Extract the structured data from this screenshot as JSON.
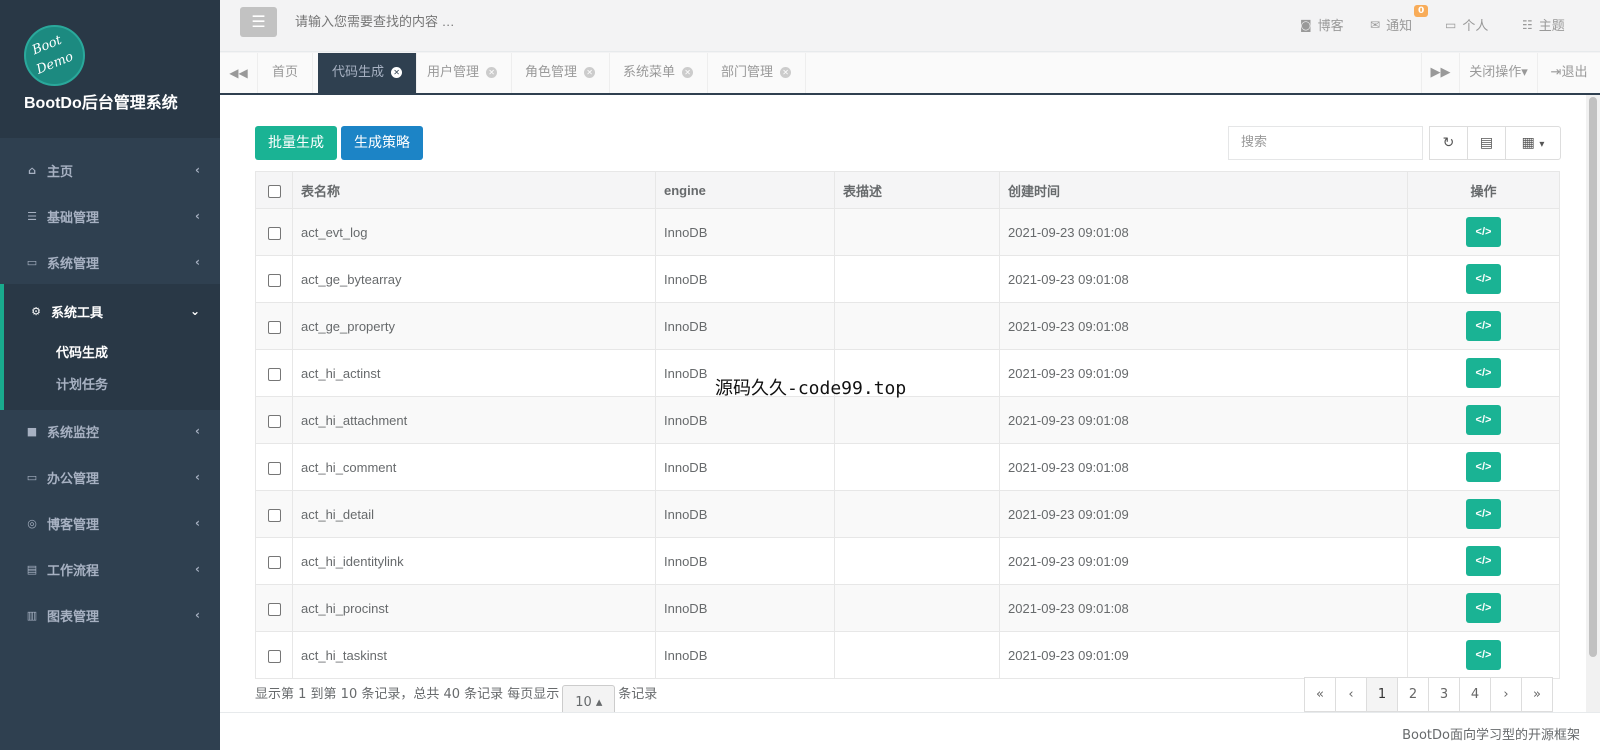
{
  "app": {
    "logo_line1": "Boot",
    "logo_line2": "Demo",
    "title": "BootDo后台管理系统"
  },
  "sidebar": {
    "items": [
      {
        "icon": "home-icon",
        "glyph": "⌂",
        "label": "主页"
      },
      {
        "icon": "bars-icon",
        "glyph": "☰",
        "label": "基础管理"
      },
      {
        "icon": "desktop-icon",
        "glyph": "▭",
        "label": "系统管理"
      },
      {
        "icon": "gear-icon",
        "glyph": "⚙",
        "label": "系统工具"
      },
      {
        "icon": "video-icon",
        "glyph": "■",
        "label": "系统监控"
      },
      {
        "icon": "laptop-icon",
        "glyph": "▭",
        "label": "办公管理"
      },
      {
        "icon": "rss-icon",
        "glyph": "◎",
        "label": "博客管理"
      },
      {
        "icon": "print-icon",
        "glyph": "▤",
        "label": "工作流程"
      },
      {
        "icon": "bar-chart-icon",
        "glyph": "▥",
        "label": "图表管理"
      }
    ],
    "subitems": [
      {
        "label": "代码生成"
      },
      {
        "label": "计划任务"
      }
    ]
  },
  "topbar": {
    "search_placeholder": "请输入您需要查找的内容 …",
    "blog_label": "博客",
    "notify_label": "通知",
    "notify_count": "0",
    "personal_label": "个人",
    "theme_label": "主题"
  },
  "tabs": {
    "items": [
      {
        "label": "首页"
      },
      {
        "label": "代码生成"
      },
      {
        "label": "用户管理"
      },
      {
        "label": "角色管理"
      },
      {
        "label": "系统菜单"
      },
      {
        "label": "部门管理"
      }
    ],
    "close_ops_label": "关闭操作",
    "logout_label": "退出"
  },
  "toolbar": {
    "batch_label": "批量生成",
    "strategy_label": "生成策略",
    "search_placeholder": "搜索"
  },
  "table": {
    "headers": [
      "表名称",
      "engine",
      "表描述",
      "创建时间",
      "操作"
    ],
    "rows": [
      {
        "name": "act_evt_log",
        "engine": "InnoDB",
        "desc": "",
        "created": "2021-09-23 09:01:08"
      },
      {
        "name": "act_ge_bytearray",
        "engine": "InnoDB",
        "desc": "",
        "created": "2021-09-23 09:01:08"
      },
      {
        "name": "act_ge_property",
        "engine": "InnoDB",
        "desc": "",
        "created": "2021-09-23 09:01:08"
      },
      {
        "name": "act_hi_actinst",
        "engine": "InnoDB",
        "desc": "",
        "created": "2021-09-23 09:01:09"
      },
      {
        "name": "act_hi_attachment",
        "engine": "InnoDB",
        "desc": "",
        "created": "2021-09-23 09:01:08"
      },
      {
        "name": "act_hi_comment",
        "engine": "InnoDB",
        "desc": "",
        "created": "2021-09-23 09:01:08"
      },
      {
        "name": "act_hi_detail",
        "engine": "InnoDB",
        "desc": "",
        "created": "2021-09-23 09:01:09"
      },
      {
        "name": "act_hi_identitylink",
        "engine": "InnoDB",
        "desc": "",
        "created": "2021-09-23 09:01:09"
      },
      {
        "name": "act_hi_procinst",
        "engine": "InnoDB",
        "desc": "",
        "created": "2021-09-23 09:01:08"
      },
      {
        "name": "act_hi_taskinst",
        "engine": "InnoDB",
        "desc": "",
        "created": "2021-09-23 09:01:09"
      }
    ],
    "action_glyph": "</>"
  },
  "pagination": {
    "info_prefix": "显示第 1 到第 10 条记录，总共 40 条记录 每页显示",
    "page_size": "10 ▴",
    "info_suffix": "条记录",
    "pages": [
      "«",
      "‹",
      "1",
      "2",
      "3",
      "4",
      "›",
      "»"
    ],
    "current": "1"
  },
  "watermark": "源码久久-code99.top",
  "footer": {
    "text": "BootDo面向学习型的开源框架"
  },
  "colors": {
    "sidebar_bg": "#2f4050",
    "accent": "#1ab394",
    "info": "#1c84c6",
    "badge": "#f8ac59"
  }
}
